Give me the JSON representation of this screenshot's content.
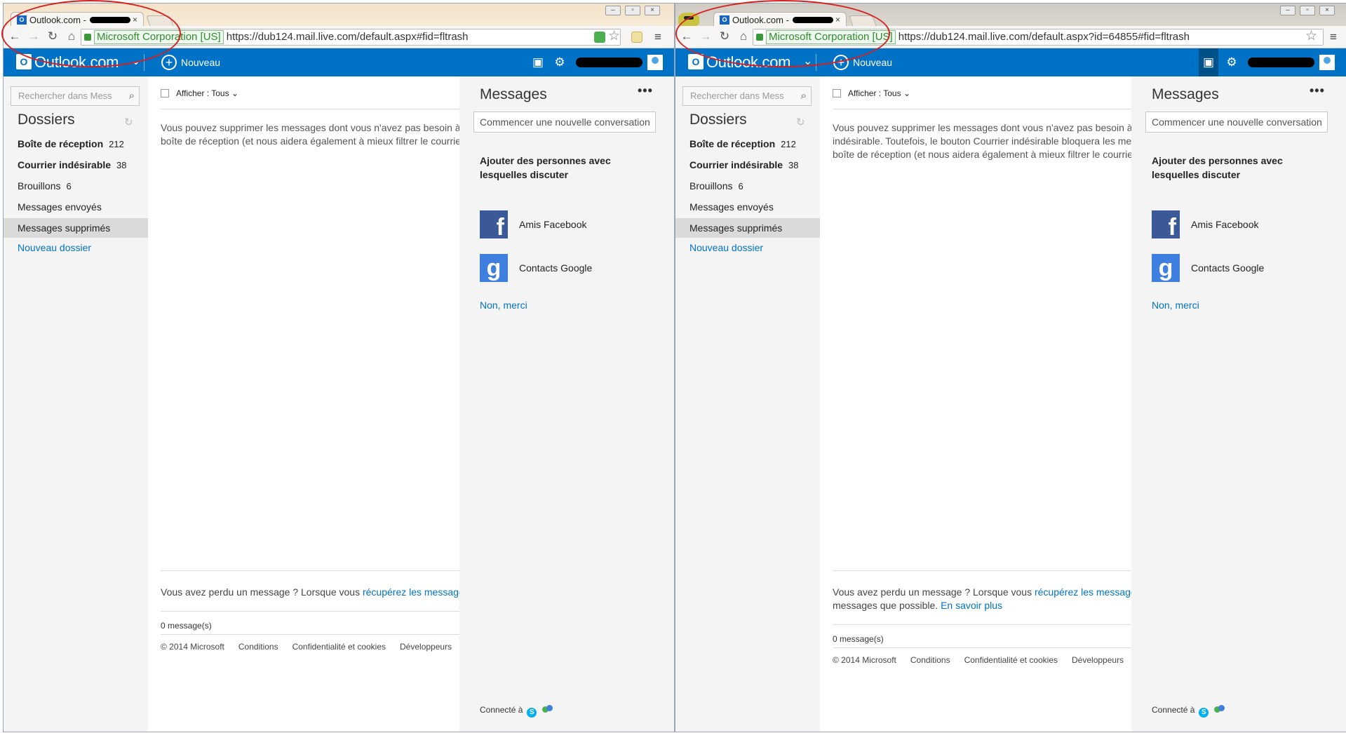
{
  "windows": {
    "left": {
      "tab_title": "Outlook.com -",
      "ev_label": "Microsoft Corporation [US]",
      "url": "https://dub124.mail.live.com/default.aspx#fid=fltrash",
      "info_text": "Vous pouvez supprimer les messages dont vous n'avez pas besoin à l'",
      "info_text2": "boîte de réception (et nous aidera également à mieux filtrer le courrier",
      "info_text3": "",
      "lost_text": "Vous avez perdu un message ? Lorsque vous",
      "lost_link": "récupérez les messages",
      "lost_text2": "",
      "lost_more": ""
    },
    "right": {
      "tab_title": "Outlook.com -",
      "ev_label": "Microsoft Corporation [US]",
      "url": "https://dub124.mail.live.com/default.aspx?id=64855#fid=fltrash",
      "info_text": "Vous pouvez supprimer les messages dont vous n'avez pas besoin à l'",
      "info_text2": "indésirable. Toutefois, le bouton Courrier indésirable bloquera les mes",
      "info_text3": "boîte de réception (et nous aidera également à mieux filtrer le courrier",
      "lost_text": "Vous avez perdu un message ? Lorsque vous",
      "lost_link": "récupérez les messages",
      "lost_text2": "messages que possible.",
      "lost_more": "En savoir plus"
    }
  },
  "outlook": {
    "brand": "Outlook.com",
    "new_label": "Nouveau",
    "search_placeholder": "Rechercher dans Mess",
    "folders_title": "Dossiers",
    "folders": [
      {
        "label": "Boîte de réception",
        "count": "212"
      },
      {
        "label": "Courrier indésirable",
        "count": "38"
      },
      {
        "label": "Brouillons",
        "count": "6"
      },
      {
        "label": "Messages envoyés",
        "count": ""
      },
      {
        "label": "Messages supprimés",
        "count": ""
      }
    ],
    "new_folder": "Nouveau dossier",
    "filter_label": "Afficher : Tous",
    "message_count": "0 message(s)",
    "footer": [
      "© 2014 Microsoft",
      "Conditions",
      "Confidentialité et cookies",
      "Développeurs"
    ],
    "messages_title": "Messages",
    "new_conversation": "Commencer une nouvelle conversation",
    "add_people": "Ajouter des personnes avec lesquelles discuter",
    "facebook": "Amis Facebook",
    "google": "Contacts Google",
    "no_thanks": "Non, merci",
    "connected": "Connecté à"
  },
  "colors": {
    "outlook_blue": "#0072c6",
    "annotation_red": "#d62020"
  }
}
